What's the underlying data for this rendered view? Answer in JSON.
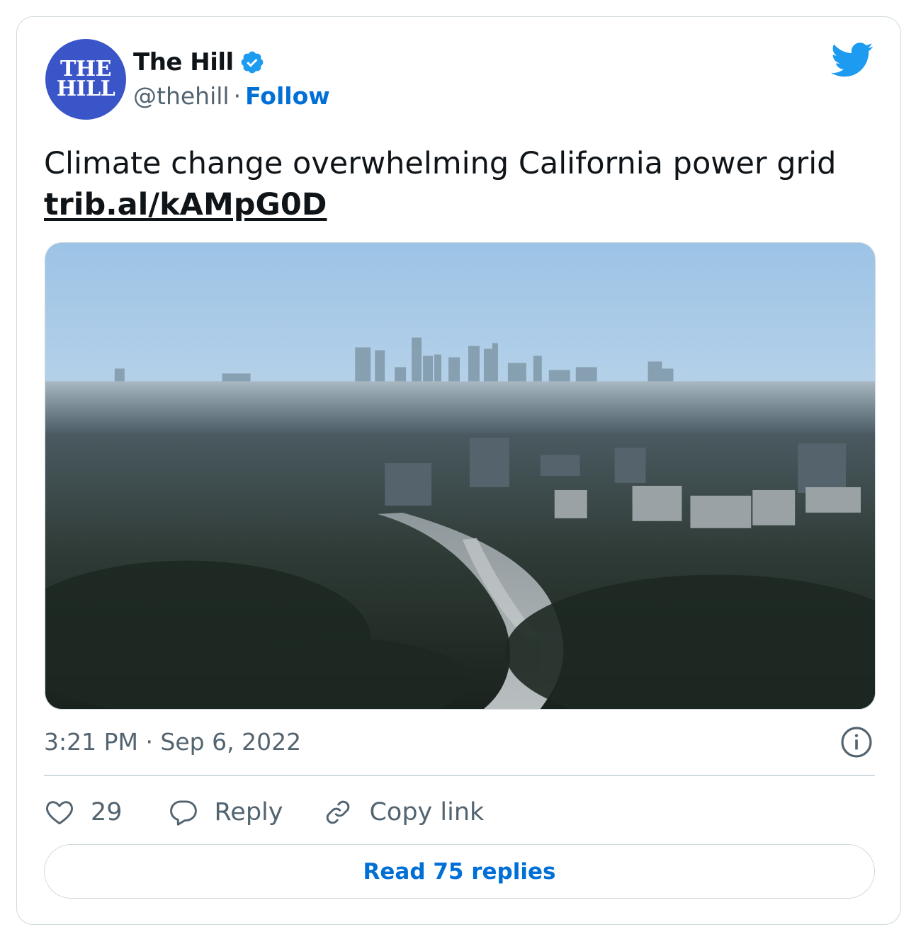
{
  "author": {
    "name": "The Hill",
    "handle": "@thehill",
    "separator": "·",
    "follow_label": "Follow",
    "avatar_lines": [
      "THE",
      "HILL"
    ],
    "verified": true,
    "avatar_color": "#3a55c8"
  },
  "tweet": {
    "text": "Climate change overwhelming California power grid",
    "link": "trib.al/kAMpG0D"
  },
  "media": {
    "icon": "city-skyline-photo"
  },
  "meta": {
    "timestamp": "3:21 PM · Sep 6, 2022"
  },
  "actions": {
    "like_count": "29",
    "reply_label": "Reply",
    "copy_link_label": "Copy link"
  },
  "read_replies_label": "Read 75 replies",
  "colors": {
    "accent": "#006fd6",
    "twitter_blue": "#1d9bf0",
    "text_primary": "#0f1419",
    "text_secondary": "#536471",
    "border": "#cfd9de"
  }
}
